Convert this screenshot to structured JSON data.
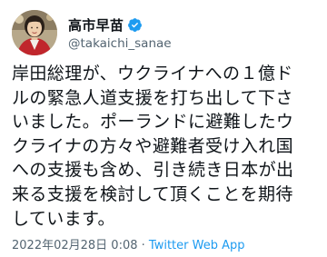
{
  "user": {
    "display_name": "高市早苗",
    "handle": "@takaichi_sanae",
    "avatar_icon": "profile-photo",
    "verified_icon": "verified-badge-icon",
    "verified_color": "#1d9bf0"
  },
  "tweet": {
    "text_lines": [
      "岸田総理が、ウクライナへの１億ド",
      "ルの緊急人道支援を打ち出して下さ",
      "いました。ポーランドに避難したウ",
      "クライナの方々や避難者受け入れ国",
      "への支援も含め、引き続き日本が出",
      "来る支援を検討して頂くことを期待",
      "しています。"
    ]
  },
  "meta": {
    "timestamp": "2022年02月28日 0:08",
    "separator": " · ",
    "source": "Twitter Web App"
  }
}
